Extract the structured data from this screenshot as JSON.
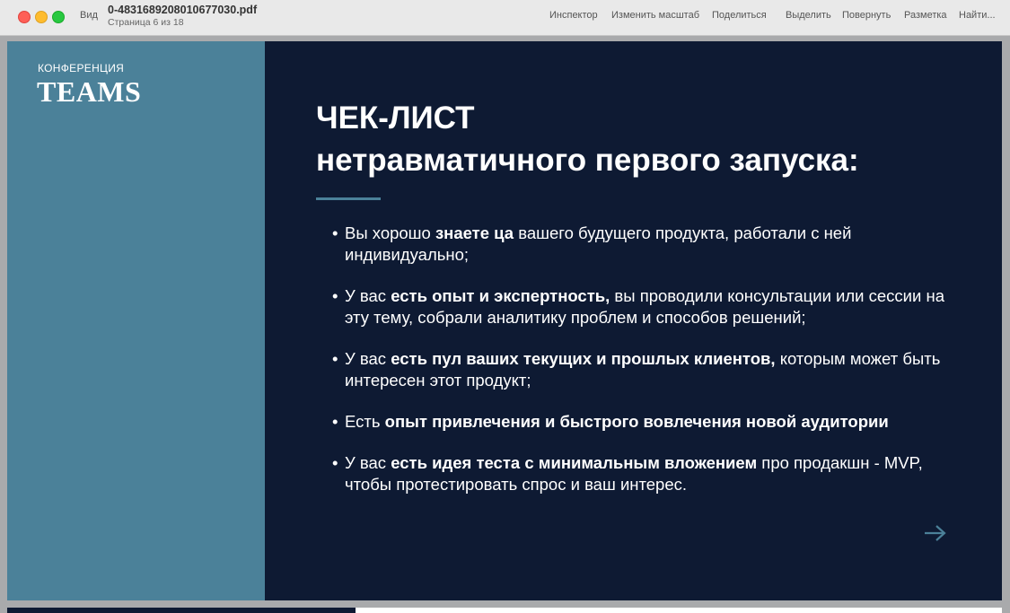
{
  "window": {
    "view_label": "Вид",
    "title": "0-4831689208010677030.pdf",
    "subtitle": "Страница 6 из 18",
    "toolbar": {
      "inspector": "Инспектор",
      "zoom": "Изменить масштаб",
      "share": "Поделиться",
      "select": "Выделить",
      "rotate": "Повернуть",
      "markup": "Разметка",
      "find": "Найти..."
    }
  },
  "slide": {
    "brand_small": "КОНФЕРЕНЦИЯ",
    "brand_big": "TEAMS",
    "heading_line1": "ЧЕК-ЛИСТ",
    "heading_line2": "нетравматичного первого запуска:",
    "items": [
      {
        "pre": "Вы хорошо ",
        "bold": "знаете ца",
        "post": " вашего будущего продукта, работали с ней индивидуально;"
      },
      {
        "pre": "У вас ",
        "bold": "есть опыт и экспертность,",
        "post": " вы проводили консультации или сессии на эту тему, собрали аналитику проблем и способов решений;"
      },
      {
        "pre": "У вас ",
        "bold": "есть пул ваших текущих и прошлых клиентов,",
        "post": " которым может быть интересен этот продукт;"
      },
      {
        "pre": "Есть ",
        "bold": "опыт привлечения и быстрого вовлечения новой аудитории",
        "post": ""
      },
      {
        "pre": "У вас ",
        "bold": "есть идея теста с минимальным вложением",
        "post": " про продакшн - MVP, чтобы протестировать спрос и ваш интерес."
      }
    ],
    "next_icon": "arrow-right-icon"
  },
  "colors": {
    "slide_bg": "#0e1a33",
    "accent": "#4b8199"
  }
}
